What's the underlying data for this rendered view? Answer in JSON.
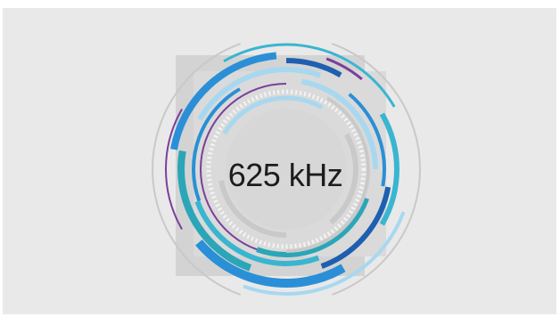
{
  "widget": {
    "frequency_label": "625 kHz"
  },
  "colors": {
    "panel_bg": "#e9e9e9",
    "ring_blue": "#2a8fd6",
    "ring_cyan": "#3ab5d0",
    "ring_teal": "#2ba6b8",
    "ring_purple": "#7b3f9a",
    "ring_light_blue": "#a8d8ef",
    "ring_gray": "#c9c9c9",
    "ring_dark_blue": "#1e5fb0"
  }
}
